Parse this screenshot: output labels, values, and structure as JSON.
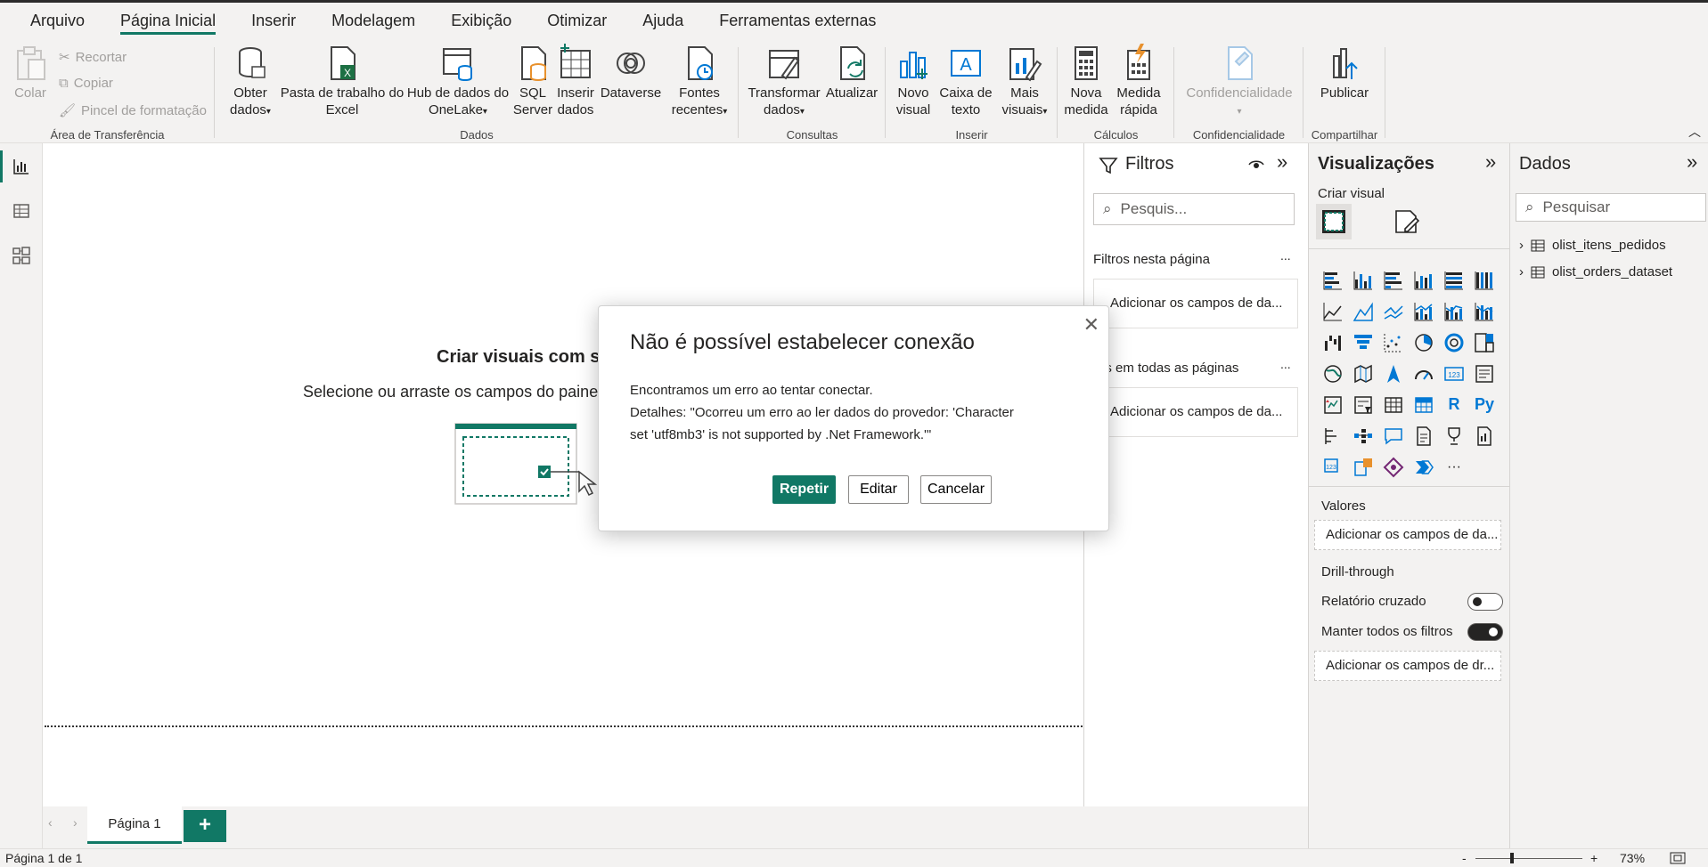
{
  "menu": {
    "tabs": [
      "Arquivo",
      "Página Inicial",
      "Inserir",
      "Modelagem",
      "Exibição",
      "Otimizar",
      "Ajuda",
      "Ferramentas externas"
    ]
  },
  "ribbon": {
    "clipboard": {
      "paste": "Colar",
      "cut": "Recortar",
      "copy": "Copiar",
      "format_painter": "Pincel de formatação",
      "group": "Área de Transferência"
    },
    "data": {
      "get_data_1": "Obter",
      "get_data_2": "dados",
      "excel_1": "Pasta de trabalho do",
      "excel_2": "Excel",
      "onelake_1": "Hub de dados do",
      "onelake_2": "OneLake",
      "sql_1": "SQL",
      "sql_2": "Server",
      "enter_1": "Inserir",
      "enter_2": "dados",
      "dataverse": "Dataverse",
      "recent_1": "Fontes",
      "recent_2": "recentes",
      "group": "Dados"
    },
    "queries": {
      "transform_1": "Transformar",
      "transform_2": "dados",
      "refresh": "Atualizar",
      "group": "Consultas"
    },
    "insert": {
      "visual_1": "Novo",
      "visual_2": "visual",
      "textbox_1": "Caixa de",
      "textbox_2": "texto",
      "more_1": "Mais",
      "more_2": "visuais",
      "group": "Inserir"
    },
    "calc": {
      "measure_1": "Nova",
      "measure_2": "medida",
      "quick_1": "Medida",
      "quick_2": "rápida",
      "group": "Cálculos"
    },
    "sensitivity": {
      "label": "Confidencialidade",
      "group": "Confidencialidade"
    },
    "share": {
      "publish": "Publicar",
      "group": "Compartilhar"
    }
  },
  "canvas": {
    "title": "Criar visuais com s",
    "subtitle": "Selecione ou arraste os campos do paine"
  },
  "pages": {
    "tab": "Página 1",
    "add": "+"
  },
  "status": {
    "page": "Página 1 de 1",
    "zoom": "73%",
    "minus": "-",
    "plus": "+"
  },
  "filters": {
    "title": "Filtros",
    "search": "Pesquis...",
    "on_page": "Filtros nesta página",
    "on_page_well": "Adicionar os campos de da...",
    "all_pages": "ros em todas as páginas",
    "all_pages_well": "Adicionar os campos de da...",
    "more": "..."
  },
  "visualizations": {
    "title": "Visualizações",
    "build": "Criar visual",
    "values": "Valores",
    "values_well": "Adicionar os campos de da...",
    "drill": "Drill-through",
    "cross_report": "Relatório cruzado",
    "cross_report_on": false,
    "keep_filters": "Manter todos os filtros",
    "keep_filters_on": true,
    "drill_well": "Adicionar os campos de dr...",
    "r_label": "R",
    "py_label": "Py",
    "more": "···",
    "kpi": "123"
  },
  "datapane": {
    "title": "Dados",
    "search": "Pesquisar",
    "tables": [
      "olist_itens_pedidos",
      "olist_orders_dataset"
    ]
  },
  "dialog": {
    "title": "Não é possível estabelecer conexão",
    "line1": "Encontramos um erro ao tentar conectar.",
    "line2": "Detalhes: \"Ocorreu um erro ao ler dados do provedor: 'Character",
    "line3": "set 'utf8mb3' is not supported by .Net Framework.'\"",
    "retry": "Repetir",
    "edit": "Editar",
    "cancel": "Cancelar",
    "close": "✕"
  },
  "colors": {
    "accent": "#117865"
  }
}
